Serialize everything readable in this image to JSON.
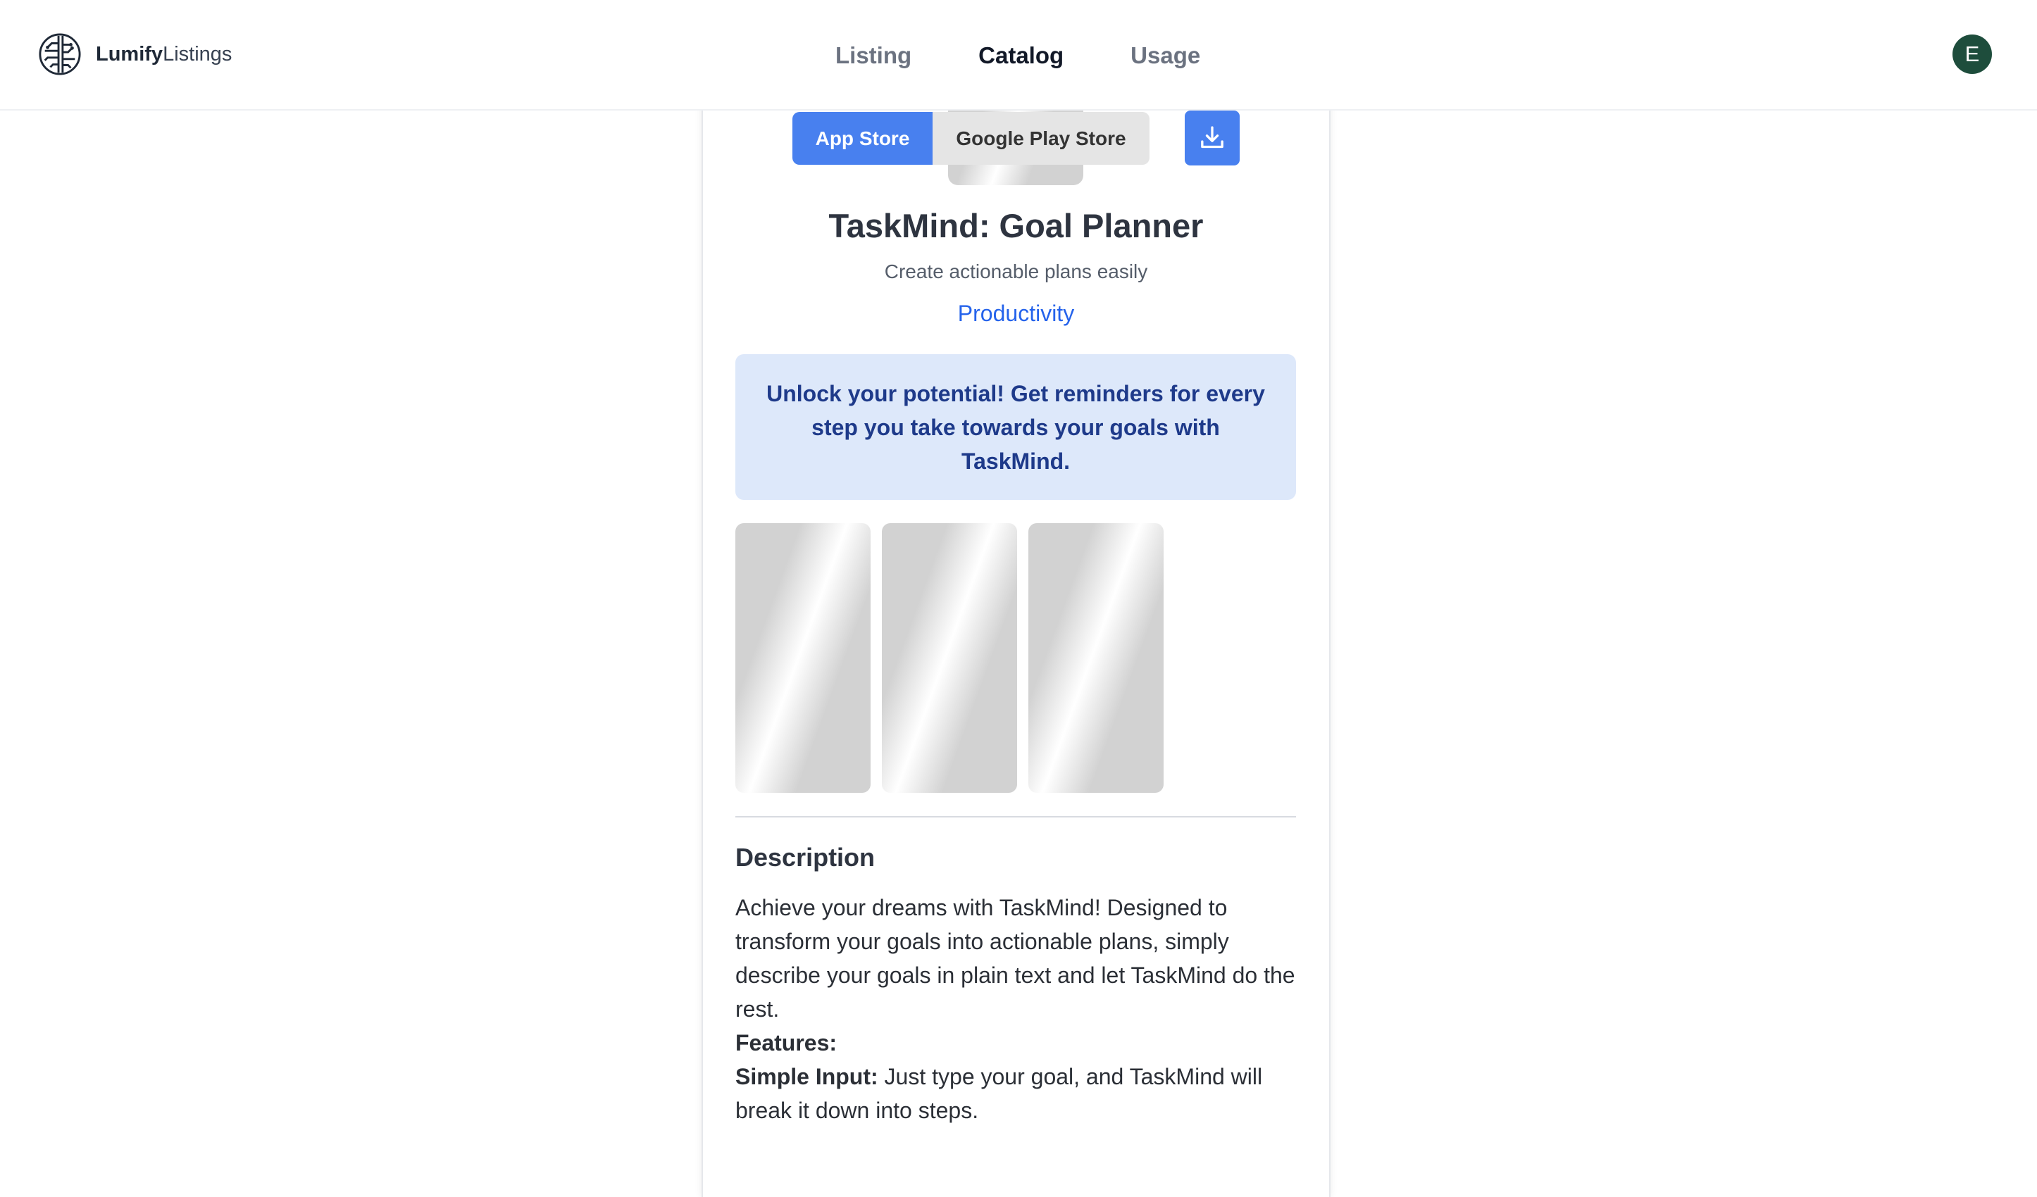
{
  "brand": {
    "name_bold": "Lumify",
    "name_regular": "Listings",
    "logo_icon": "circuit-globe-icon"
  },
  "nav": {
    "items": [
      {
        "label": "Listing"
      },
      {
        "label": "Catalog",
        "active": true
      },
      {
        "label": "Usage"
      }
    ]
  },
  "user": {
    "avatar_initial": "E",
    "avatar_color": "#1e4d3c"
  },
  "store_toggle": {
    "app_store": "App Store",
    "google_play": "Google Play Store",
    "selected": "App Store",
    "accent": "#4880ef"
  },
  "download": {
    "icon": "download-icon"
  },
  "app": {
    "title": "TaskMind: Goal Planner",
    "subtitle": "Create actionable plans easily",
    "category": "Productivity",
    "promo": "Unlock your potential! Get reminders for every step you take towards your goals with TaskMind."
  },
  "screenshots": {
    "count": 3
  },
  "description": {
    "heading": "Description",
    "intro": "Achieve your dreams with TaskMind! Designed to transform your goals into actionable plans, simply describe your goals in plain text and let TaskMind do the rest.",
    "features_label": "Features:",
    "feature_1_label": "Simple Input:",
    "feature_1_text": " Just type your goal, and TaskMind will break it down into steps."
  }
}
